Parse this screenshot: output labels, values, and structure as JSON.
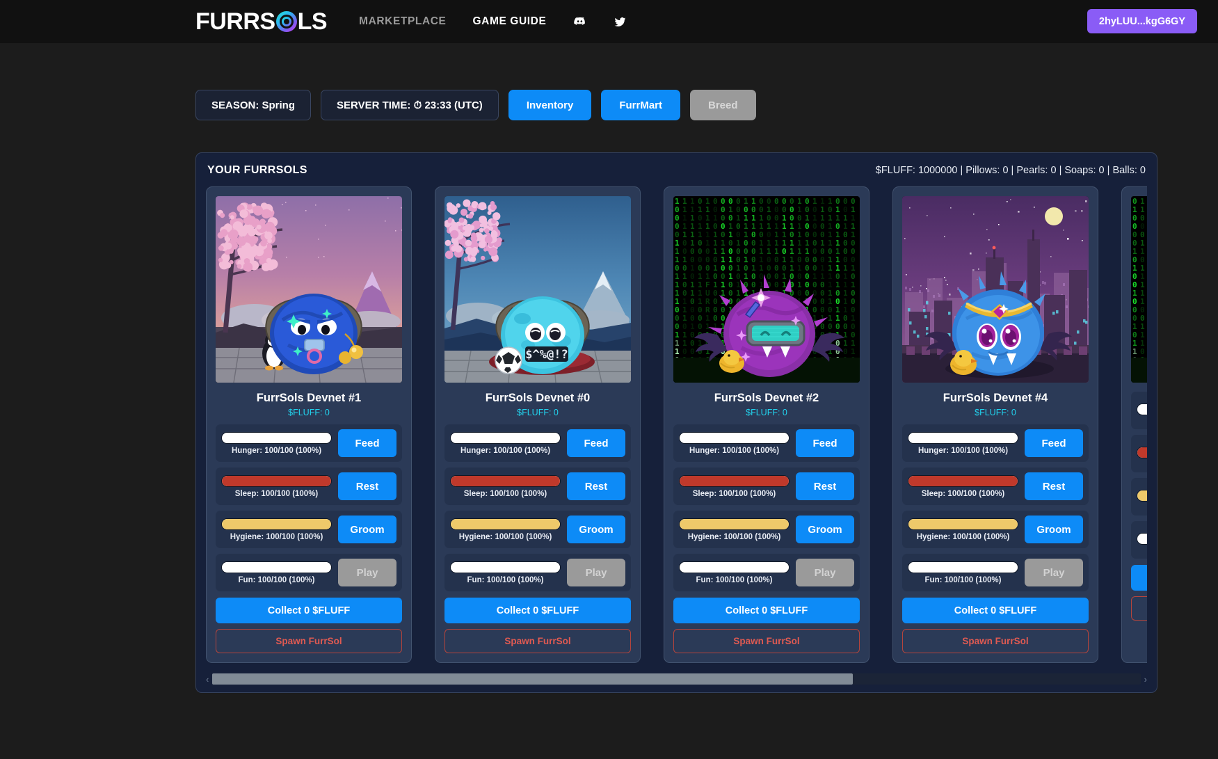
{
  "header": {
    "brand_left": "FURRS",
    "brand_right": "LS",
    "nav": [
      {
        "label": "MARKETPLACE",
        "active": false
      },
      {
        "label": "GAME GUIDE",
        "active": true
      }
    ],
    "social": [
      {
        "icon": "discord-icon"
      },
      {
        "icon": "twitter-icon"
      }
    ],
    "wallet_label": "2hyLUU...kgG6GY",
    "wallet_color": "#8a5cf6"
  },
  "toolbar": {
    "season": "SEASON: Spring",
    "server_time": "SERVER TIME: ⏱ 23:33 (UTC)",
    "inventory_label": "Inventory",
    "furrmart_label": "FurrMart",
    "breed_label": "Breed",
    "breed_disabled": true
  },
  "panel": {
    "title": "YOUR FURRSOLS",
    "stats": "$FLUFF: 1000000 | Pillows: 0 | Pearls: 0 | Soaps: 0 | Balls: 0"
  },
  "stat_colors": {
    "hunger": "#ffffff",
    "sleep": "#c0392b",
    "hygiene": "#eec96a",
    "fun": "#ffffff"
  },
  "cards": [
    {
      "title": "FurrSols Devnet #1",
      "fluff": "$FLUFF: 0",
      "scene": "sakura-dusk",
      "stats": [
        {
          "name": "Hunger",
          "label": "Hunger: 100/100 (100%)",
          "pct": 100,
          "color": "#ffffff",
          "action": "Feed",
          "disabled": false
        },
        {
          "name": "Sleep",
          "label": "Sleep: 100/100 (100%)",
          "pct": 100,
          "color": "#c0392b",
          "action": "Rest",
          "disabled": false
        },
        {
          "name": "Hygiene",
          "label": "Hygiene: 100/100 (100%)",
          "pct": 100,
          "color": "#eec96a",
          "action": "Groom",
          "disabled": false
        },
        {
          "name": "Fun",
          "label": "Fun: 100/100 (100%)",
          "pct": 100,
          "color": "#ffffff",
          "action": "Play",
          "disabled": true
        }
      ],
      "collect": "Collect 0 $FLUFF",
      "spawn": "Spawn FurrSol"
    },
    {
      "title": "FurrSols Devnet #0",
      "fluff": "$FLUFF: 0",
      "scene": "sakura-day",
      "stats": [
        {
          "name": "Hunger",
          "label": "Hunger: 100/100 (100%)",
          "pct": 100,
          "color": "#ffffff",
          "action": "Feed",
          "disabled": false
        },
        {
          "name": "Sleep",
          "label": "Sleep: 100/100 (100%)",
          "pct": 100,
          "color": "#c0392b",
          "action": "Rest",
          "disabled": false
        },
        {
          "name": "Hygiene",
          "label": "Hygiene: 100/100 (100%)",
          "pct": 100,
          "color": "#eec96a",
          "action": "Groom",
          "disabled": false
        },
        {
          "name": "Fun",
          "label": "Fun: 100/100 (100%)",
          "pct": 100,
          "color": "#ffffff",
          "action": "Play",
          "disabled": true
        }
      ],
      "collect": "Collect 0 $FLUFF",
      "spawn": "Spawn FurrSol"
    },
    {
      "title": "FurrSols Devnet #2",
      "fluff": "$FLUFF: 0",
      "scene": "matrix",
      "stats": [
        {
          "name": "Hunger",
          "label": "Hunger: 100/100 (100%)",
          "pct": 100,
          "color": "#ffffff",
          "action": "Feed",
          "disabled": false
        },
        {
          "name": "Sleep",
          "label": "Sleep: 100/100 (100%)",
          "pct": 100,
          "color": "#c0392b",
          "action": "Rest",
          "disabled": false
        },
        {
          "name": "Hygiene",
          "label": "Hygiene: 100/100 (100%)",
          "pct": 100,
          "color": "#eec96a",
          "action": "Groom",
          "disabled": false
        },
        {
          "name": "Fun",
          "label": "Fun: 100/100 (100%)",
          "pct": 100,
          "color": "#ffffff",
          "action": "Play",
          "disabled": true
        }
      ],
      "collect": "Collect 0 $FLUFF",
      "spawn": "Spawn FurrSol"
    },
    {
      "title": "FurrSols Devnet #4",
      "fluff": "$FLUFF: 0",
      "scene": "cyber-night",
      "stats": [
        {
          "name": "Hunger",
          "label": "Hunger: 100/100 (100%)",
          "pct": 100,
          "color": "#ffffff",
          "action": "Feed",
          "disabled": false
        },
        {
          "name": "Sleep",
          "label": "Sleep: 100/100 (100%)",
          "pct": 100,
          "color": "#c0392b",
          "action": "Rest",
          "disabled": false
        },
        {
          "name": "Hygiene",
          "label": "Hygiene: 100/100 (100%)",
          "pct": 100,
          "color": "#eec96a",
          "action": "Groom",
          "disabled": false
        },
        {
          "name": "Fun",
          "label": "Fun: 100/100 (100%)",
          "pct": 100,
          "color": "#ffffff",
          "action": "Play",
          "disabled": true
        }
      ],
      "collect": "Collect 0 $FLUFF",
      "spawn": "Spawn FurrSol"
    },
    {
      "title": "",
      "fluff": "",
      "scene": "matrix",
      "stats": [
        {
          "name": "Hunger",
          "label": "",
          "pct": 100,
          "color": "#ffffff",
          "action": "",
          "disabled": false
        },
        {
          "name": "Sleep",
          "label": "",
          "pct": 100,
          "color": "#c0392b",
          "action": "",
          "disabled": false
        },
        {
          "name": "Hygiene",
          "label": "",
          "pct": 100,
          "color": "#eec96a",
          "action": "",
          "disabled": false
        },
        {
          "name": "Fun",
          "label": "",
          "pct": 100,
          "color": "#ffffff",
          "action": "",
          "disabled": false
        }
      ],
      "collect": "",
      "spawn": ""
    }
  ],
  "scrollbar": {
    "left_arrow": "‹",
    "right_arrow": "›",
    "thumb_pct": 69
  }
}
